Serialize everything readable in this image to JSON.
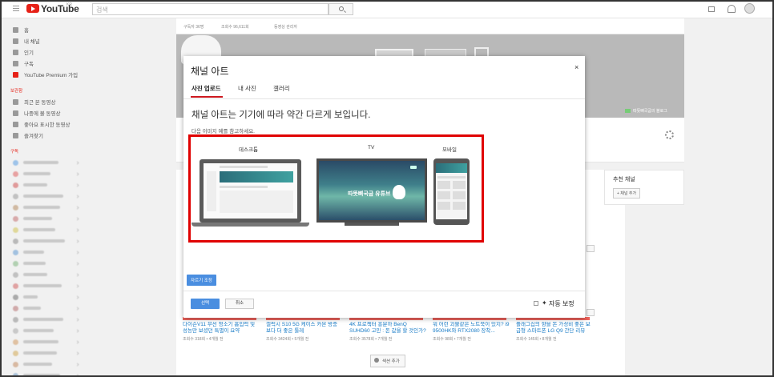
{
  "topbar": {
    "logo_text": "YouTube",
    "logo_region": "KR",
    "search_placeholder": "검색"
  },
  "sidebar": {
    "items": [
      {
        "label": "홈",
        "icon": "home-icon"
      },
      {
        "label": "내 채널",
        "icon": "person-icon"
      },
      {
        "label": "인기",
        "icon": "fire-icon"
      },
      {
        "label": "구독",
        "icon": "subscriptions-icon"
      },
      {
        "label": "YouTube Premium 가입",
        "icon": "youtube-red-icon"
      }
    ],
    "library_heading": "보관함",
    "library_items": [
      {
        "label": "최근 본 동영상",
        "icon": "history-icon"
      },
      {
        "label": "나중에 볼 동영상",
        "icon": "clock-icon"
      },
      {
        "label": "좋아요 표시한 동영상",
        "icon": "thumb-up-icon"
      },
      {
        "label": "즐겨찾기",
        "icon": "list-icon"
      }
    ],
    "subscriptions_heading": "구독"
  },
  "channel": {
    "topline": [
      "구독자 36명",
      "조회수 96,611회",
      "동영상 관리자"
    ],
    "banner_link": "따뜻뼈국굽의 블로그",
    "recommended_title": "추천 채널",
    "add_channel_button": "+ 채널 추가",
    "add_section_button": "섹션 추가"
  },
  "videos": [
    {
      "title": "다이슨V11 무선 청소기 흡입력 및 성능만 보셨던 특별이 요약",
      "meta": "조회수 318회 • 4개월 전"
    },
    {
      "title": "갤럭시 S10 5G 케이스 카본 방충 보다 더 좋은 툴레",
      "meta": "조회수 3424회 • 5개월 전"
    },
    {
      "title": "4K 프로젝터 흥분하 BenQ SUHD60 고민 : 돈 값을 할 것인가?",
      "meta": "조회수 3578회 • 7개월 전"
    },
    {
      "title": "워 어런 괴물같은 노트북이 있지? i9 9500HK와 RTX2080 장착...",
      "meta": "조회수 98회 • 7개월 전"
    },
    {
      "title": "플래그십의 향을 돈 가성비 좋은 보급형 스마트폰 LG Q9 간단 리뷰",
      "meta": "조회수 145회 • 8개월 전"
    }
  ],
  "modal": {
    "title": "채널 아트",
    "close": "×",
    "tabs": [
      "사진 업로드",
      "내 사진",
      "갤러리"
    ],
    "active_tab": 0,
    "heading": "채널 아트는 기기에 따라 약간 다르게 보입니다.",
    "subheading": "다음 이미지 예를 참고하세요.",
    "devices": [
      "데스크톱",
      "TV",
      "모바일"
    ],
    "crop_button": "자르기 조정",
    "select_button": "선택",
    "cancel_button": "취소",
    "auto_adjust_label": "자동 보정",
    "preview_banner_text": "따뜻뼈국굽 유튜브",
    "highlight_color": "#e00000",
    "accent_color": "#4a8ee0"
  }
}
